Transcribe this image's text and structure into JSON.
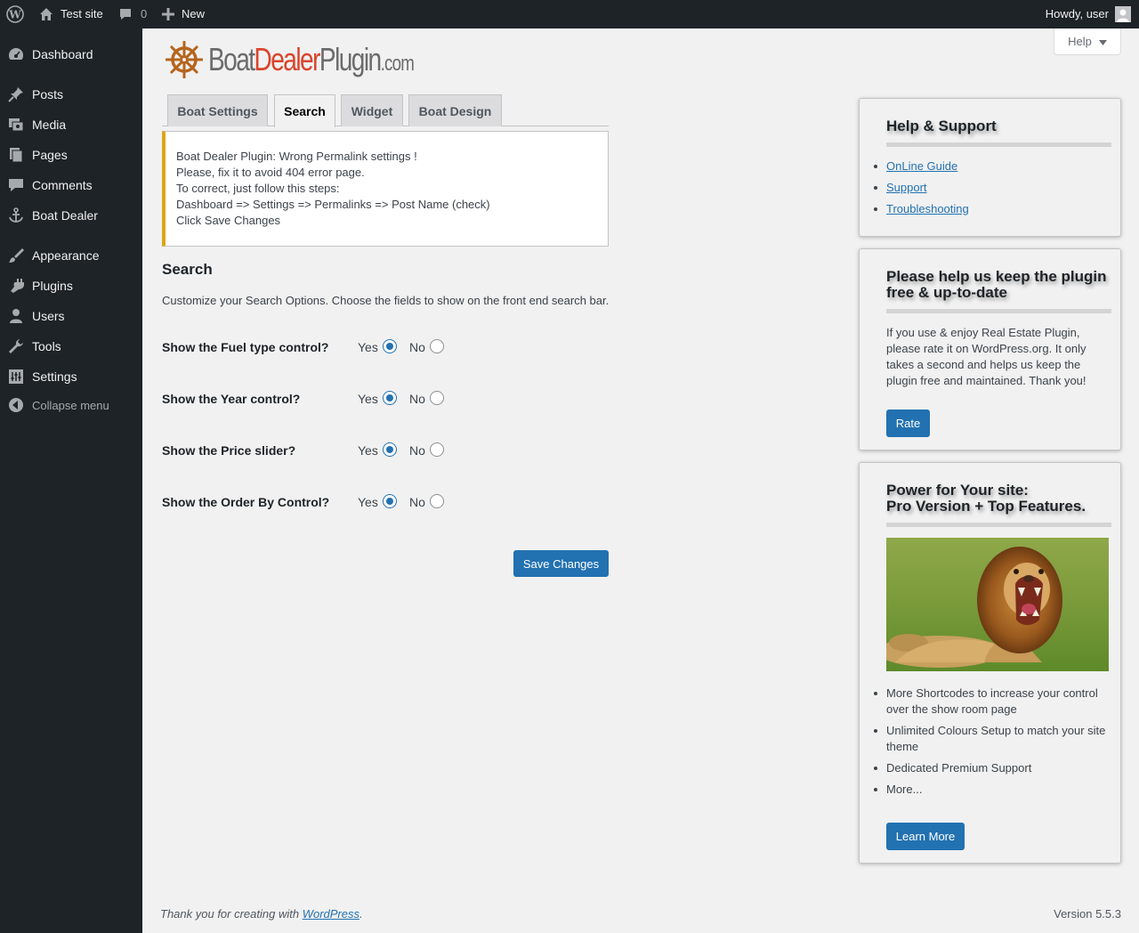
{
  "admin_bar": {
    "site_name": "Test site",
    "comments_count": "0",
    "new_label": "New",
    "howdy": "Howdy, user"
  },
  "menu": {
    "items": [
      {
        "label": "Dashboard",
        "icon": "dashboard-icon"
      },
      {
        "label": "Posts",
        "icon": "pin-icon"
      },
      {
        "label": "Media",
        "icon": "media-icon"
      },
      {
        "label": "Pages",
        "icon": "pages-icon"
      },
      {
        "label": "Comments",
        "icon": "comment-icon"
      },
      {
        "label": "Boat Dealer",
        "icon": "anchor-icon"
      },
      {
        "label": "Appearance",
        "icon": "brush-icon"
      },
      {
        "label": "Plugins",
        "icon": "plugin-icon"
      },
      {
        "label": "Users",
        "icon": "user-icon"
      },
      {
        "label": "Tools",
        "icon": "wrench-icon"
      },
      {
        "label": "Settings",
        "icon": "settings-icon"
      }
    ],
    "collapse_label": "Collapse menu"
  },
  "help_tab": {
    "label": "Help"
  },
  "logo": {
    "part1": "Boat",
    "part2": "Dealer",
    "part3": "Plugin",
    "part4": ".com"
  },
  "tabs": [
    {
      "label": "Boat Settings",
      "active": false
    },
    {
      "label": "Search",
      "active": true
    },
    {
      "label": "Widget",
      "active": false
    },
    {
      "label": "Boat Design",
      "active": false
    }
  ],
  "notice": {
    "lines": [
      "Boat Dealer Plugin: Wrong Permalink settings !",
      "Please, fix it to avoid 404 error page.",
      "To correct, just follow this steps:",
      "Dashboard => Settings => Permalinks => Post Name (check)",
      "Click Save Changes"
    ]
  },
  "search_section": {
    "title": "Search",
    "description": "Customize your Search Options. Choose the fields to show on the front end search bar.",
    "options": [
      {
        "label": "Show the Fuel type control?",
        "yes": "Yes",
        "no": "No",
        "selected": "Yes"
      },
      {
        "label": "Show the Year control?",
        "yes": "Yes",
        "no": "No",
        "selected": "Yes"
      },
      {
        "label": "Show the Price slider?",
        "yes": "Yes",
        "no": "No",
        "selected": "Yes"
      },
      {
        "label": "Show the Order By Control?",
        "yes": "Yes",
        "no": "No",
        "selected": "Yes"
      }
    ],
    "save_label": "Save Changes"
  },
  "sidebar": {
    "help_support": {
      "title": "Help & Support",
      "links": [
        "OnLine Guide",
        "Support",
        "Troubleshooting"
      ]
    },
    "rate_box": {
      "title_line1": "Please help us keep the plugin",
      "title_line2": "free & up-to-date",
      "text": "If you use & enjoy Real Estate Plugin, please rate it on WordPress.org. It only takes a second and helps us keep the plugin free and maintained. Thank you!",
      "button": "Rate"
    },
    "pro_box": {
      "title_line1": "Power for Your site:",
      "title_line2": "Pro Version + Top Features.",
      "features": [
        "More Shortcodes to increase your control over the show room page",
        "Unlimited Colours Setup to match your site theme",
        "Dedicated Premium Support",
        "More..."
      ],
      "button": "Learn More"
    }
  },
  "footer": {
    "thanks_prefix": "Thank you for creating with ",
    "thanks_link": "WordPress",
    "thanks_suffix": ".",
    "version": "Version 5.5.3"
  },
  "colors": {
    "admin_dark": "#1d2327",
    "primary": "#2271b1",
    "notice_warning": "#dba617",
    "logo_red": "#d9442b"
  }
}
